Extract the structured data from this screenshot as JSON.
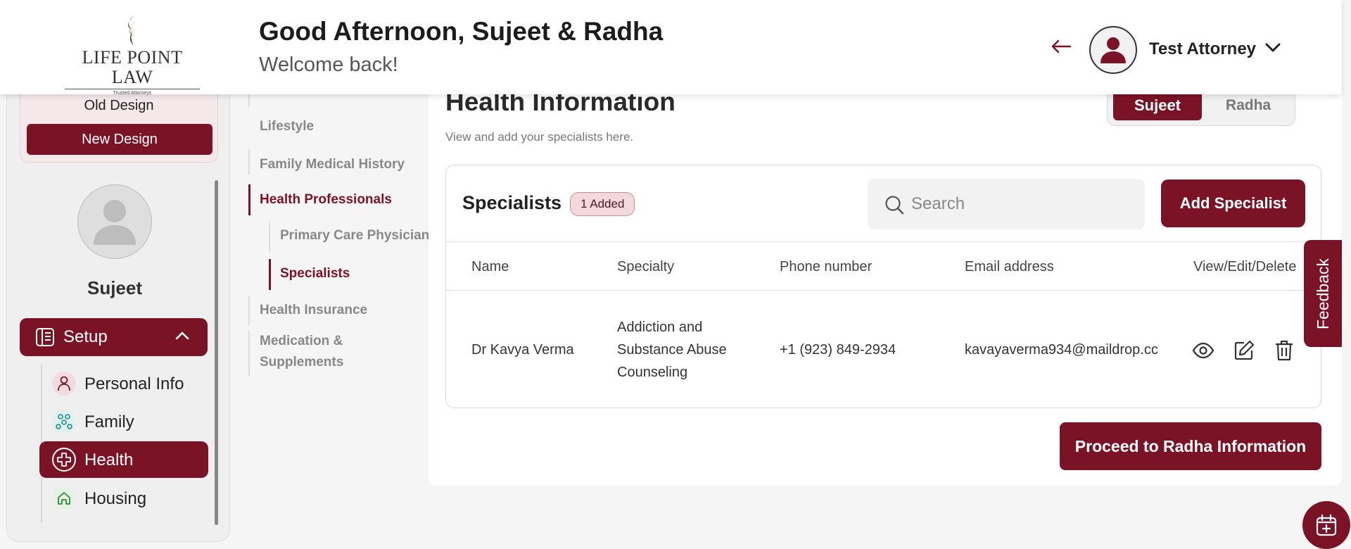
{
  "app": {
    "logo_text": "LIFE POINT LAW",
    "logo_tagline": "Trusted Attorneys"
  },
  "header": {
    "greeting": "Good Afternoon, Sujeet & Radha",
    "welcome": "Welcome back!",
    "user_name": "Test Attorney",
    "back_icon": "arrow-left-icon",
    "menu_icon": "chevron-down-icon"
  },
  "sidebar": {
    "old_design_label": "Old Design",
    "new_design_label": "New Design",
    "profile_name": "Sujeet",
    "setup_label": "Setup",
    "items": [
      {
        "label": "Personal Info",
        "icon": "person-icon"
      },
      {
        "label": "Family",
        "icon": "family-icon"
      },
      {
        "label": "Health",
        "icon": "health-cross-icon",
        "active": true
      },
      {
        "label": "Housing",
        "icon": "house-icon"
      }
    ]
  },
  "subnav": {
    "items": [
      {
        "label": "Lifestyle"
      },
      {
        "label": "Family Medical History"
      },
      {
        "label": "Health Professionals",
        "active": true
      },
      {
        "label": "Primary Care Physician"
      },
      {
        "label": "Specialists",
        "active": true
      },
      {
        "label": "Health Insurance"
      },
      {
        "label": "Medication &"
      },
      {
        "label": "Supplements"
      }
    ]
  },
  "main": {
    "title": "Health Information",
    "subtitle": "View and add your specialists here.",
    "person_toggle": {
      "selected": "Sujeet",
      "other": "Radha"
    }
  },
  "specialists": {
    "title": "Specialists",
    "badge": "1 Added",
    "search_placeholder": "Search",
    "search_value": "",
    "add_label": "Add Specialist",
    "columns": [
      "Name",
      "Specialty",
      "Phone number",
      "Email address",
      "View/Edit/Delete"
    ],
    "rows": [
      {
        "name": "Dr Kavya Verma",
        "specialty_lines": [
          "Addiction and",
          "Substance Abuse",
          "Counseling"
        ],
        "phone": "+1 (923) 849-2934",
        "email": "kavayaverma934@maildrop.cc"
      }
    ]
  },
  "proceed_label": "Proceed to Radha Information",
  "feedback_label": "Feedback",
  "colors": {
    "brand": "#7b1327",
    "brand_light": "#f6e9ec",
    "logo_gold": "#c8892a"
  }
}
